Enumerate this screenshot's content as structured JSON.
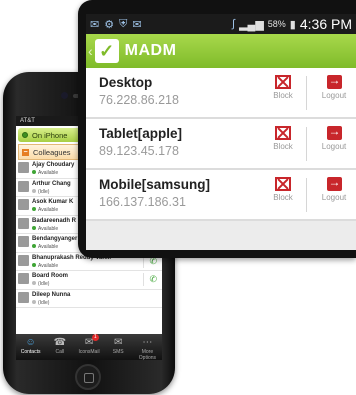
{
  "iphone": {
    "status": {
      "carrier": "AT&T"
    },
    "on_iphone_label": "On iPhone",
    "group_label": "Colleagues",
    "contacts": [
      {
        "name": "Ajay Choudary",
        "status": "Available"
      },
      {
        "name": "Arthur Chang",
        "status": "(Idle)"
      },
      {
        "name": "Asok Kumar K",
        "status": "Available"
      },
      {
        "name": "Badareenadh R",
        "status": "Available"
      },
      {
        "name": "Bendangyanger Imchen...",
        "status": "Available"
      },
      {
        "name": "Bhanuprakash Reddy Van...",
        "status": "Available"
      },
      {
        "name": "Board Room",
        "status": "(Idle)"
      },
      {
        "name": "Dileep Nunna",
        "status": "(Idle)"
      }
    ],
    "tabs": [
      {
        "label": "Contacts",
        "icon": "contacts-icon",
        "glyph": "☺"
      },
      {
        "label": "Call",
        "icon": "call-icon",
        "glyph": "☎"
      },
      {
        "label": "IconsMail",
        "icon": "chat-icon",
        "glyph": "✉",
        "badge": "1"
      },
      {
        "label": "SMS",
        "icon": "sms-icon",
        "glyph": "✉"
      },
      {
        "label": "More Options",
        "icon": "more-icon",
        "glyph": "⋯"
      }
    ]
  },
  "android": {
    "status": {
      "battery": "58%",
      "time": "4:36 PM"
    },
    "app_title": "MADM",
    "devices": [
      {
        "name": "Desktop",
        "ip": "76.228.86.218",
        "block_label": "Block",
        "logout_label": "Logout"
      },
      {
        "name": "Tablet[apple]",
        "ip": "89.123.45.178",
        "block_label": "Block",
        "logout_label": "Logout"
      },
      {
        "name": "Mobile[samsung]",
        "ip": "166.137.186.31",
        "block_label": "Block",
        "logout_label": "Logout"
      }
    ]
  },
  "colors": {
    "accent_green": "#8cc63f",
    "danger_red": "#c8262b"
  }
}
